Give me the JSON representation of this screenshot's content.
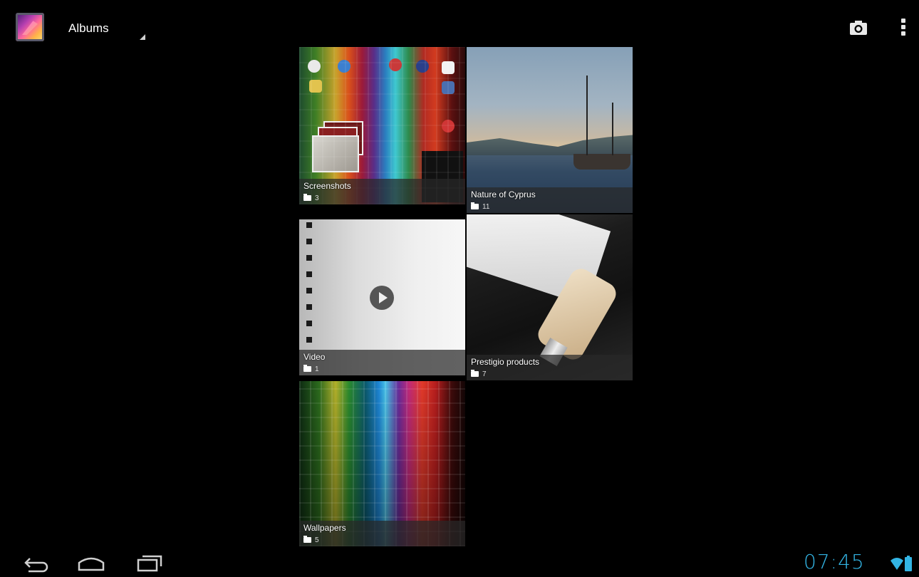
{
  "action_bar": {
    "view_selector": "Albums",
    "icons": [
      "gallery-app-icon",
      "camera-icon",
      "overflow-menu-icon"
    ]
  },
  "albums": [
    {
      "name": "Screenshots",
      "count": "3"
    },
    {
      "name": "Nature of Cyprus",
      "count": "11"
    },
    {
      "name": "Video",
      "count": "1"
    },
    {
      "name": "Prestigio products",
      "count": "7"
    },
    {
      "name": "Wallpapers",
      "count": "5"
    }
  ],
  "system_bar": {
    "time": "07:45",
    "nav_icons": [
      "back-icon",
      "home-icon",
      "recent-apps-icon"
    ],
    "status_icons": [
      "wifi-icon",
      "battery-icon"
    ],
    "accent_color": "#33b5e5"
  }
}
